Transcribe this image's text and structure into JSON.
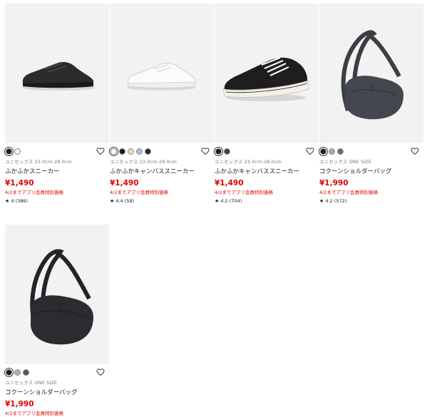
{
  "products": [
    {
      "swatches": [
        "#1c1c1c",
        "#f4f4f4"
      ],
      "meta": "ユニセックス 23.0cm-28.0cm",
      "name": "ふかふかスニーカー",
      "price": "¥1,490",
      "promo": "4/2までアプリ会員特別価格",
      "rating": "4",
      "reviews": "(386)",
      "image": "black-leather-sneaker"
    },
    {
      "swatches": [
        "#ffffff",
        "#1c1c1c",
        "#e9dfb4",
        "#a8bfd3",
        "#2a2a2a"
      ],
      "meta": "ユニセックス 23.0cm-28.0cm",
      "name": "ふかふかキャンバススニーカー",
      "price": "¥1,490",
      "promo": "4/2までアプリ会員特別価格",
      "rating": "4.4",
      "reviews": "(58)",
      "image": "white-canvas-sneaker"
    },
    {
      "swatches": [
        "#1c1c1c",
        "#3a3f4a"
      ],
      "meta": "ユニセックス 23.0cm-28.0cm",
      "name": "ふかふかキャンバススニーカー",
      "price": "¥1,490",
      "promo": "4/2までアプリ会員特別価格",
      "rating": "4.2",
      "reviews": "(704)",
      "image": "black-canvas-sneaker"
    },
    {
      "swatches": [
        "#1c1c1c",
        "#b9a890",
        "#6b6b6b"
      ],
      "meta": "ユニセックス ONE SIZE",
      "name": "コクーンショルダーバッグ",
      "price": "¥1,990",
      "promo": "4/2までアプリ会員特別価格",
      "rating": "4.2",
      "reviews": "(572)",
      "image": "gray-shoulder-bag"
    },
    {
      "swatches": [
        "#1c1c1c",
        "#b9b39d",
        "#555555"
      ],
      "meta": "ユニセックス ONE SIZE",
      "name": "コクーンショルダーバッグ",
      "price": "¥1,990",
      "promo": "4/2までアプリ会員特別価格",
      "image": "black-shoulder-bag"
    }
  ],
  "icons": {
    "favorite": "heart-outline-icon",
    "star": "★"
  },
  "colors": {
    "price": "#e00000",
    "promo": "#e00000"
  }
}
